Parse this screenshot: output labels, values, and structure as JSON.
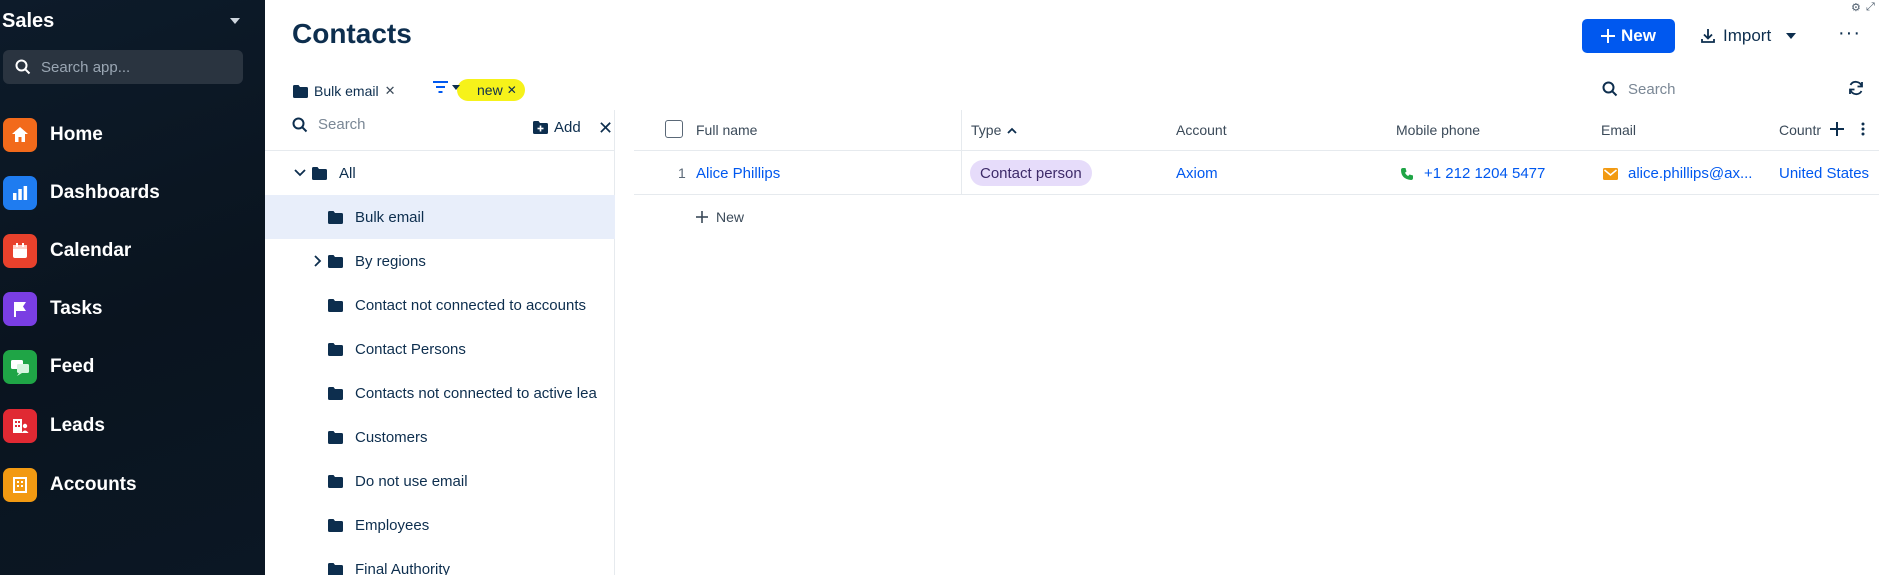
{
  "sidebar": {
    "app_name": "Sales",
    "search_placeholder": "Search app...",
    "items": [
      {
        "label": "Home",
        "icon": "home-icon",
        "color": "#f26a1b"
      },
      {
        "label": "Dashboards",
        "icon": "bar-chart-icon",
        "color": "#1f7cf0"
      },
      {
        "label": "Calendar",
        "icon": "calendar-icon",
        "color": "#e8412c"
      },
      {
        "label": "Tasks",
        "icon": "flag-icon",
        "color": "#7a3ee3"
      },
      {
        "label": "Feed",
        "icon": "chat-icon",
        "color": "#1fa546"
      },
      {
        "label": "Leads",
        "icon": "leads-icon",
        "color": "#e02933"
      },
      {
        "label": "Accounts",
        "icon": "building-icon",
        "color": "#f29a12"
      }
    ]
  },
  "header": {
    "title": "Contacts",
    "new_label": "New",
    "import_label": "Import"
  },
  "filters": {
    "folder_chip": "Bulk email",
    "tag_chip": "new",
    "search_placeholder": "Search"
  },
  "folders": {
    "search_placeholder": "Search",
    "add_label": "Add",
    "items": [
      {
        "label": "All",
        "expanded": true
      },
      {
        "label": "Bulk email",
        "selected": true
      },
      {
        "label": "By regions",
        "collapsed": true
      },
      {
        "label": "Contact not connected to accounts"
      },
      {
        "label": "Contact Persons"
      },
      {
        "label": "Contacts not connected to active lea"
      },
      {
        "label": "Customers"
      },
      {
        "label": "Do not use email"
      },
      {
        "label": "Employees"
      },
      {
        "label": "Final Authority"
      }
    ]
  },
  "table": {
    "columns": [
      "Full name",
      "Type",
      "Account",
      "Mobile phone",
      "Email",
      "Countr"
    ],
    "rows": [
      {
        "index": "1",
        "full_name": "Alice Phillips",
        "type": "Contact person",
        "account": "Axiom",
        "mobile_phone": "+1 212 1204 5477",
        "email": "alice.phillips@ax...",
        "country": "United States"
      }
    ],
    "add_new_label": "New"
  },
  "colors": {
    "primary": "#0058ef",
    "sidebar_bg": "#0d1b2a",
    "highlight": "#f6f21a",
    "badge_bg": "#e6dcfa"
  }
}
